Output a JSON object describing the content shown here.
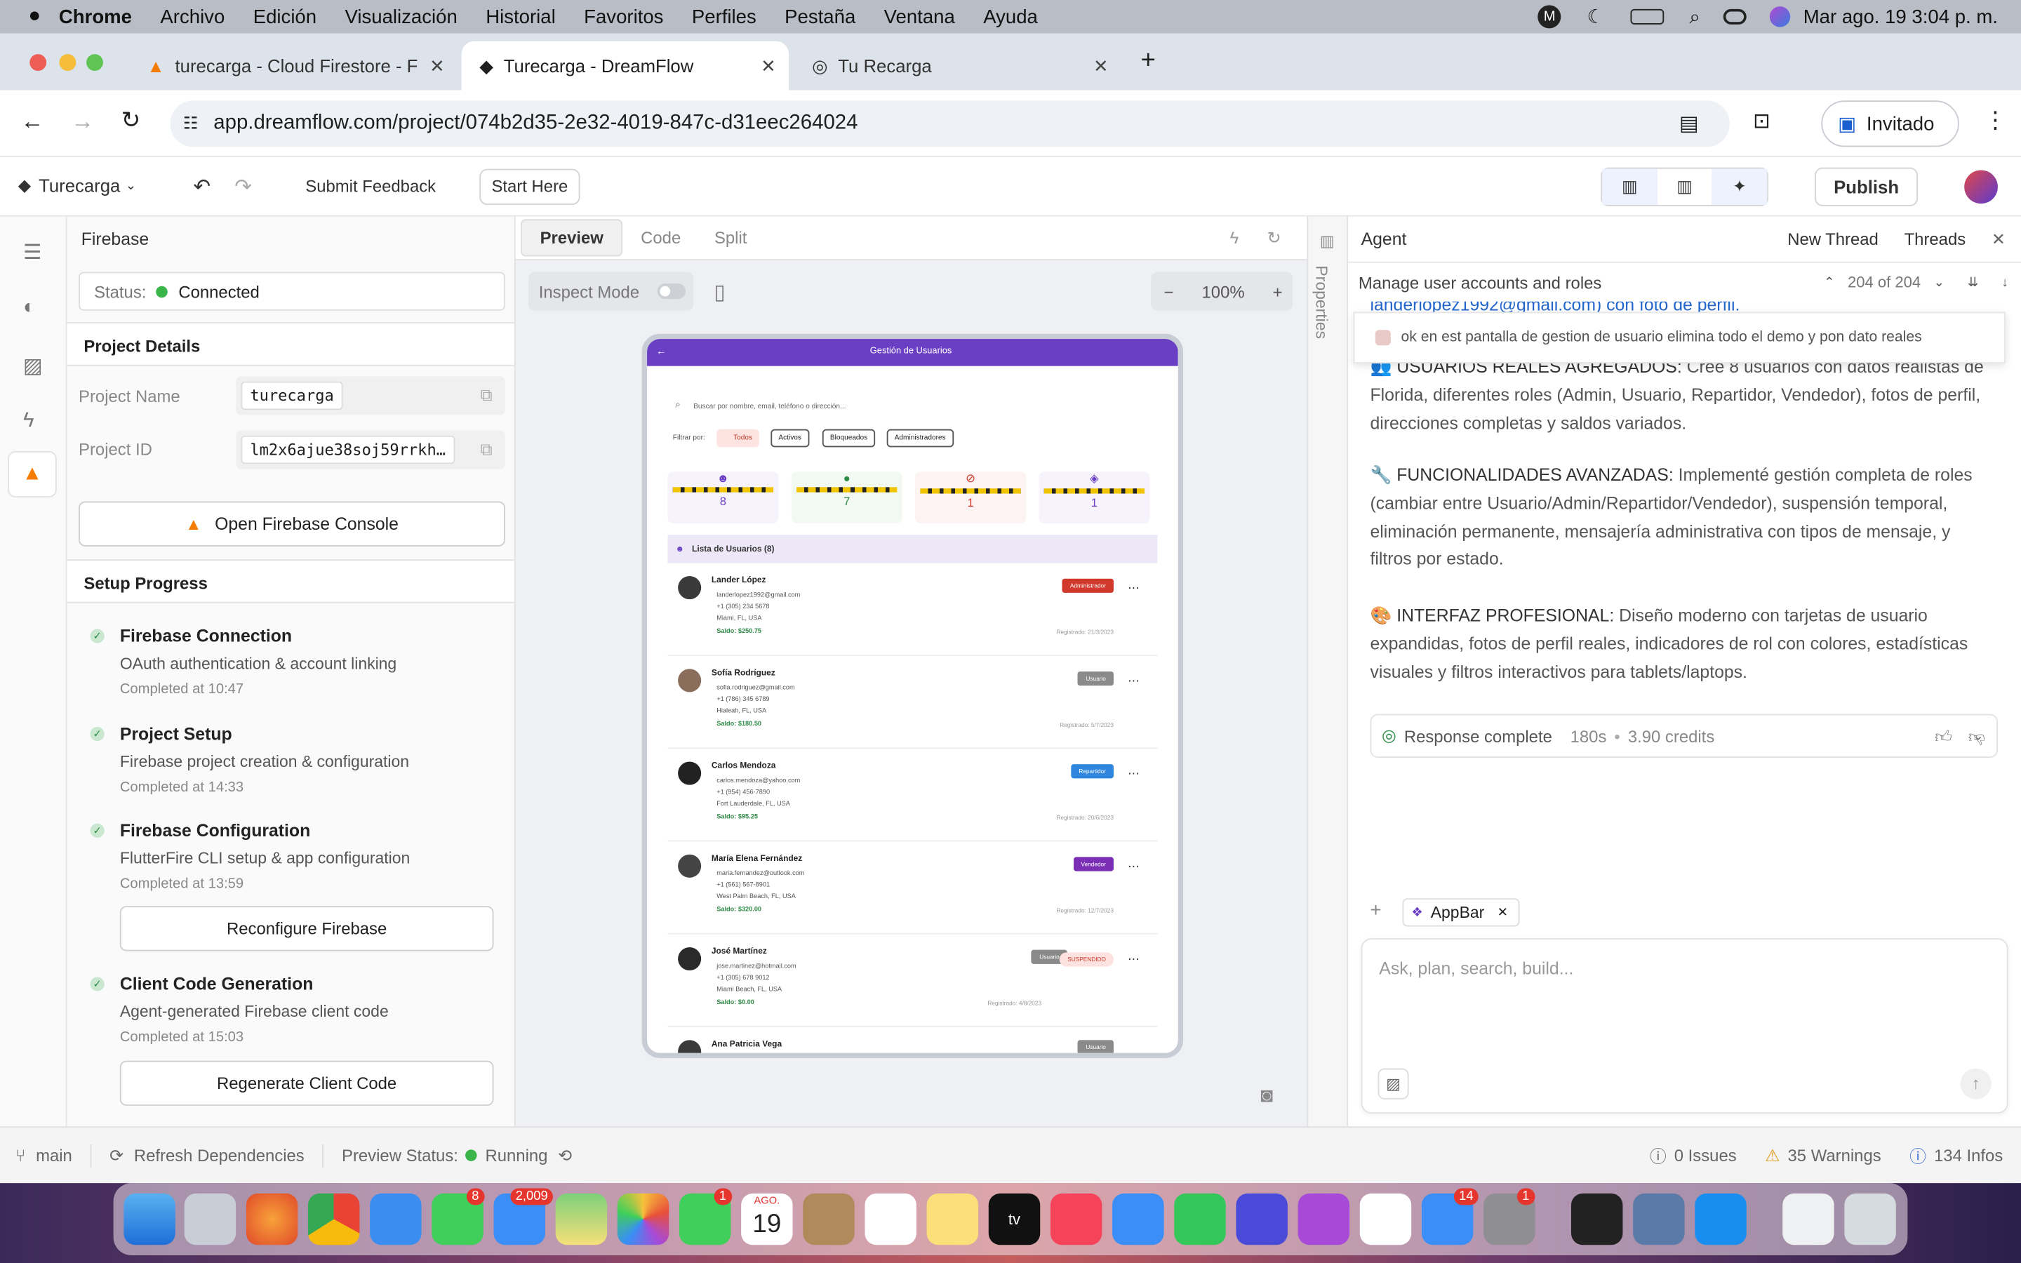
{
  "menubar": {
    "app": "Chrome",
    "items": [
      "Archivo",
      "Edición",
      "Visualización",
      "Historial",
      "Favoritos",
      "Perfiles",
      "Pestaña",
      "Ventana",
      "Ayuda"
    ],
    "clock": "Mar ago. 19  3:04 p. m."
  },
  "tabs": [
    {
      "title": "turecarga - Cloud Firestore - F"
    },
    {
      "title": "Turecarga - DreamFlow"
    },
    {
      "title": "Tu Recarga"
    }
  ],
  "address": {
    "url": "app.dreamflow.com/project/074b2d35-2e32-4019-847c-d31eec264024",
    "profile": "Invitado"
  },
  "toolbar": {
    "project": "Turecarga",
    "feedback": "Submit Feedback",
    "start": "Start Here",
    "publish": "Publish"
  },
  "firebase": {
    "title": "Firebase",
    "status_label": "Status:",
    "status_value": "Connected",
    "details_title": "Project Details",
    "name_label": "Project Name",
    "name_value": "turecarga",
    "id_label": "Project ID",
    "id_value": "lm2x6ajue38soj59rrkh…",
    "console_btn": "Open Firebase Console",
    "setup_title": "Setup Progress",
    "steps": [
      {
        "title": "Firebase Connection",
        "sub": "OAuth authentication & account linking",
        "time": "Completed at 10:47"
      },
      {
        "title": "Project Setup",
        "sub": "Firebase project creation & configuration",
        "time": "Completed at 14:33"
      },
      {
        "title": "Firebase Configuration",
        "sub": "FlutterFire CLI setup & app configuration",
        "time": "Completed at 13:59",
        "btn": "Reconfigure Firebase"
      },
      {
        "title": "Client Code Generation",
        "sub": "Agent-generated Firebase client code",
        "time": "Completed at 15:03",
        "btn": "Regenerate Client Code"
      }
    ]
  },
  "preview": {
    "tabs": [
      "Preview",
      "Code",
      "Split"
    ],
    "inspect": "Inspect Mode",
    "zoom": "100%"
  },
  "phone": {
    "title": "Gestión de Usuarios",
    "search": "Buscar por nombre, email, teléfono o dirección...",
    "filter_label": "Filtrar por:",
    "chips": [
      "Todos",
      "Activos",
      "Bloqueados",
      "Administradores"
    ],
    "stats": [
      "8",
      "7",
      "1",
      "1"
    ],
    "list_title": "Lista de Usuarios (8)",
    "users": [
      {
        "name": "Lander López",
        "email": "landerlopez1992@gmail.com",
        "phone": "+1 (305) 234 5678",
        "city": "Miami, FL, USA",
        "balance": "Saldo: $250.75",
        "role": "Administrador",
        "reg": "Registrado: 21/3/2023"
      },
      {
        "name": "Sofía Rodríguez",
        "email": "sofia.rodriguez@gmail.com",
        "phone": "+1 (786) 345 6789",
        "city": "Hialeah, FL, USA",
        "balance": "Saldo: $180.50",
        "role": "Usuario",
        "reg": "Registrado: 5/7/2023"
      },
      {
        "name": "Carlos Mendoza",
        "email": "carlos.mendoza@yahoo.com",
        "phone": "+1 (954) 456-7890",
        "city": "Fort Lauderdale, FL, USA",
        "balance": "Saldo: $95.25",
        "role": "Repartidor",
        "reg": "Registrado: 20/6/2023"
      },
      {
        "name": "María Elena Fernández",
        "email": "maria.fernandez@outlook.com",
        "phone": "+1 (561) 567-8901",
        "city": "West Palm Beach, FL, USA",
        "balance": "Saldo: $320.00",
        "role": "Vendedor",
        "reg": "Registrado: 12/7/2023"
      },
      {
        "name": "José Martínez",
        "email": "jose.martinez@hotmail.com",
        "phone": "+1 (305) 678 9012",
        "city": "Miami Beach, FL, USA",
        "balance": "Saldo: $0.00",
        "role": "Usuario",
        "extra": "SUSPENDIDO",
        "reg": "Registrado: 4/8/2023"
      },
      {
        "name": "Ana Patricia Vega",
        "role": "Usuario"
      }
    ]
  },
  "properties_label": "Properties",
  "agent": {
    "title": "Agent",
    "new_thread": "New Thread",
    "threads": "Threads",
    "subject": "Manage user accounts and roles",
    "counter": "204 of 204",
    "cut_line": "landerlopez1992@gmail.com) con foto de perfil.",
    "user_msg": "ok en est pantalla de gestion de usuario elimina todo el demo y pon dato reales",
    "p1_head": "👥 USUARIOS REALES AGREGADOS:",
    "p1": "Creé 8 usuarios con datos realistas de Florida, diferentes roles (Admin, Usuario, Repartidor, Vendedor), fotos de perfil, direcciones completas y saldos variados.",
    "p2_head": "🔧 FUNCIONALIDADES AVANZADAS:",
    "p2": "Implementé gestión completa de roles (cambiar entre Usuario/Admin/Repartidor/Vendedor), suspensión temporal, eliminación permanente, mensajería administrativa con tipos de mensaje, y filtros por estado.",
    "p3_head": "🎨 INTERFAZ PROFESIONAL:",
    "p3": "Diseño moderno con tarjetas de usuario expandidas, fotos de perfil reales, indicadores de rol con colores, estadísticas visuales y filtros interactivos para tablets/laptops.",
    "response": "Response complete",
    "time": "180s",
    "credits": "3.90 credits",
    "chip": "AppBar",
    "placeholder": "Ask, plan, search, build..."
  },
  "statusbar": {
    "branch": "main",
    "refresh": "Refresh Dependencies",
    "preview_label": "Preview Status:",
    "preview_value": "Running",
    "issues": "0 Issues",
    "warnings": "35 Warnings",
    "infos": "134 Infos"
  },
  "dock": {
    "badges": [
      "8",
      "2,009",
      "1",
      "14",
      "1"
    ],
    "cal_month": "AGO.",
    "cal_day": "19"
  }
}
